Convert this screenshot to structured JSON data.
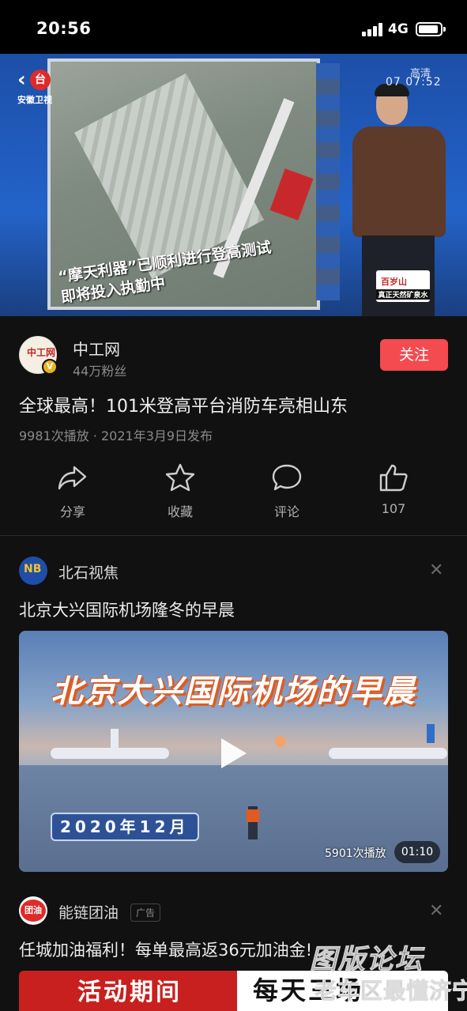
{
  "status_bar": {
    "time": "20:56",
    "network": "4G"
  },
  "video_player": {
    "channel_logo": "安徽卫视",
    "quality": "高清",
    "clock": "07 07:52",
    "caption_line1": "“摩天利器”已顺利进行登高测试",
    "caption_line2": "即将投入执勤中",
    "ad_brand": "百岁山",
    "ad_slogan": "真正天然矿泉水"
  },
  "publisher": {
    "name": "中工网",
    "fans": "44万粉丝",
    "follow_label": "关注",
    "avatar_text": "中工网"
  },
  "video": {
    "title": "全球最高！101米登高平台消防车亮相山东",
    "meta": "9981次播放 · 2021年3月9日发布"
  },
  "actions": [
    {
      "label": "分享",
      "icon": "share-icon"
    },
    {
      "label": "收藏",
      "icon": "star-icon"
    },
    {
      "label": "评论",
      "icon": "comment-icon"
    },
    {
      "label": "107",
      "icon": "thumbs-up-icon"
    }
  ],
  "recommendations": [
    {
      "source": "北石视焦",
      "title": "北京大兴国际机场隆冬的早晨",
      "thumb_banner": "北京大兴国际机场的早晨",
      "thumb_date": "2020年12月",
      "views": "5901次播放",
      "duration": "01:10"
    },
    {
      "source": "能链团油",
      "ad_badge": "广告",
      "avatar_text": "团油",
      "title": "任城加油福利！每单最高返36元加油金!",
      "ad_text": "活动期间",
      "ad_text2": "每天三场"
    }
  ],
  "watermark": {
    "line1": "图版论坛",
    "line2": "老车区最懂济宁"
  },
  "colors": {
    "accent": "#f34b4f",
    "background": "#111111"
  }
}
